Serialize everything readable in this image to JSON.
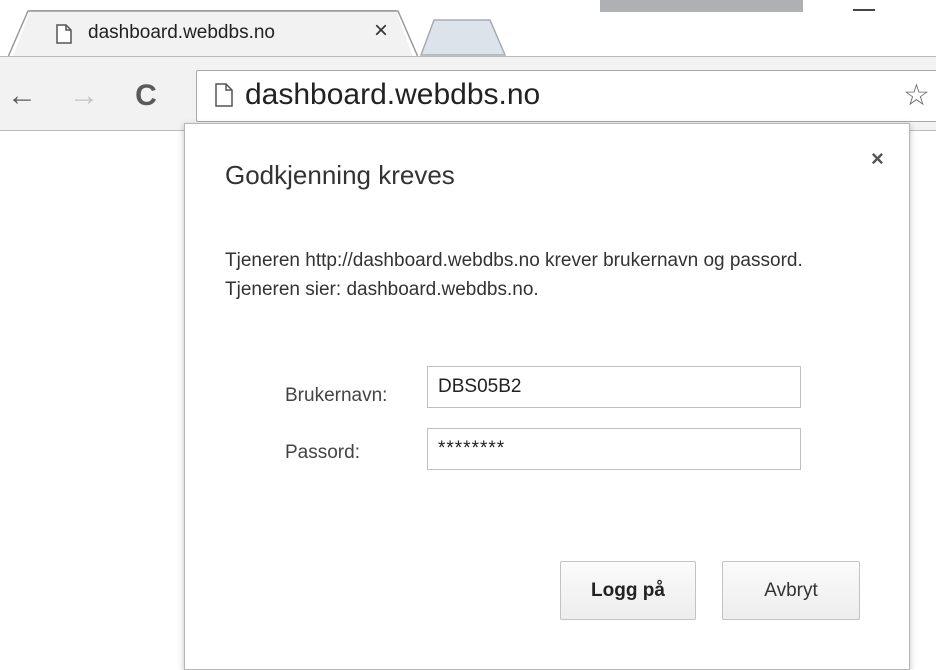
{
  "browser": {
    "tab": {
      "title": "dashboard.webdbs.no",
      "close_label": "×"
    },
    "toolbar": {
      "back_label": "←",
      "forward_label": "→",
      "reload_label": "C",
      "url": "dashboard.webdbs.no",
      "bookmark_label": "☆"
    }
  },
  "dialog": {
    "close_label": "×",
    "title": "Godkjenning kreves",
    "message": "Tjeneren http://dashboard.webdbs.no krever brukernavn og passord. Tjeneren sier: dashboard.webdbs.no.",
    "username_label": "Brukernavn:",
    "username_value": "DBS05B2",
    "password_label": "Passord:",
    "password_value": "********",
    "login_button": "Logg på",
    "cancel_button": "Avbryt"
  },
  "icons": {
    "tab": "page-icon",
    "omnibox": "page-icon",
    "bookmark": "star-icon"
  }
}
